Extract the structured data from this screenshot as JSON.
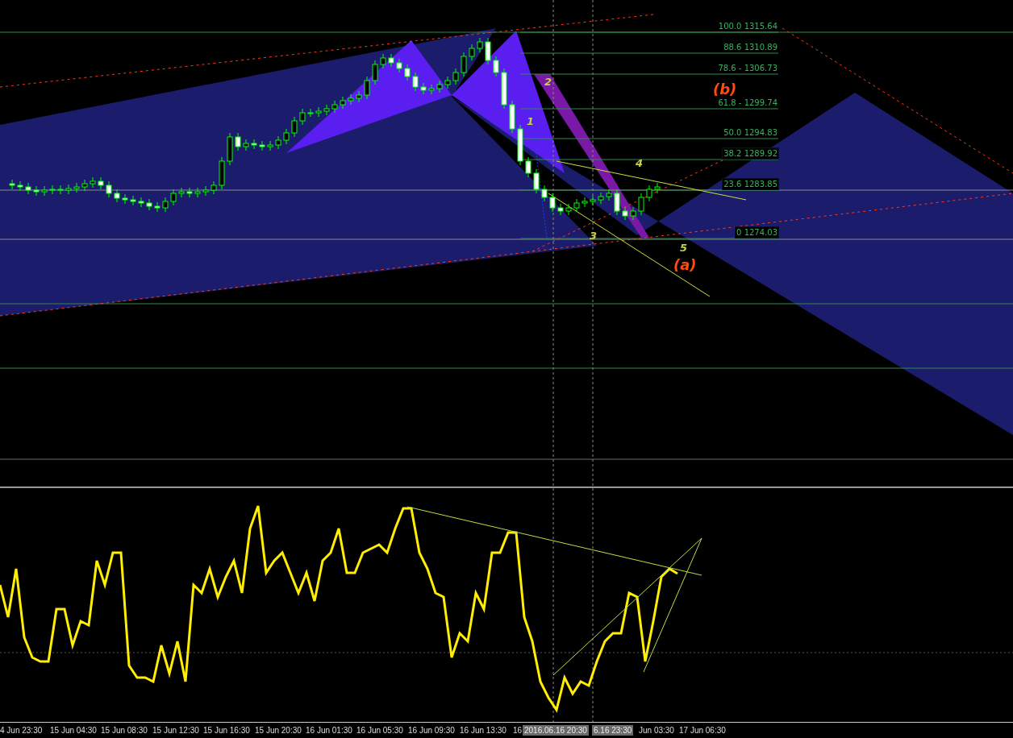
{
  "fib_levels": [
    {
      "label": "100.0 1315.64",
      "boxed": false
    },
    {
      "label": "88.6 1310.89",
      "boxed": false
    },
    {
      "label": "78.6 - 1306.73",
      "boxed": false
    },
    {
      "label": "61.8 - 1299.74",
      "boxed": false
    },
    {
      "label": "50.0 1294.83",
      "boxed": false
    },
    {
      "label": "38.2 1289.92",
      "boxed": true
    },
    {
      "label": "23.6 1283.85",
      "boxed": true
    },
    {
      "label": "0 1274.03",
      "boxed": true
    }
  ],
  "wave_labels": [
    {
      "text": "1",
      "kind": "minor"
    },
    {
      "text": "2",
      "kind": "minor"
    },
    {
      "text": "3",
      "kind": "minor"
    },
    {
      "text": "4",
      "kind": "minor"
    },
    {
      "text": "5",
      "kind": "minor"
    },
    {
      "text": "(a)",
      "kind": "major"
    },
    {
      "text": "(b)",
      "kind": "major"
    }
  ],
  "time_axis": [
    {
      "text": "4 Jun 23:30",
      "kind": "tick"
    },
    {
      "text": "15 Jun 04:30",
      "kind": "tick"
    },
    {
      "text": "15 Jun 08:30",
      "kind": "tick"
    },
    {
      "text": "15 Jun 12:30",
      "kind": "tick"
    },
    {
      "text": "15 Jun 16:30",
      "kind": "tick"
    },
    {
      "text": "15 Jun 20:30",
      "kind": "tick"
    },
    {
      "text": "16 Jun 01:30",
      "kind": "tick"
    },
    {
      "text": "16 Jun 05:30",
      "kind": "tick"
    },
    {
      "text": "16 Jun 09:30",
      "kind": "tick"
    },
    {
      "text": "16 Jun 13:30",
      "kind": "tick"
    },
    {
      "text": "16",
      "kind": "tick"
    },
    {
      "text": "2016.06.16 20:30",
      "kind": "cursor"
    },
    {
      "text": "6.16 23:30",
      "kind": "cursor"
    },
    {
      "text": "Jun 03:30",
      "kind": "tick"
    },
    {
      "text": "17 Jun 06:30",
      "kind": "tick"
    }
  ]
}
